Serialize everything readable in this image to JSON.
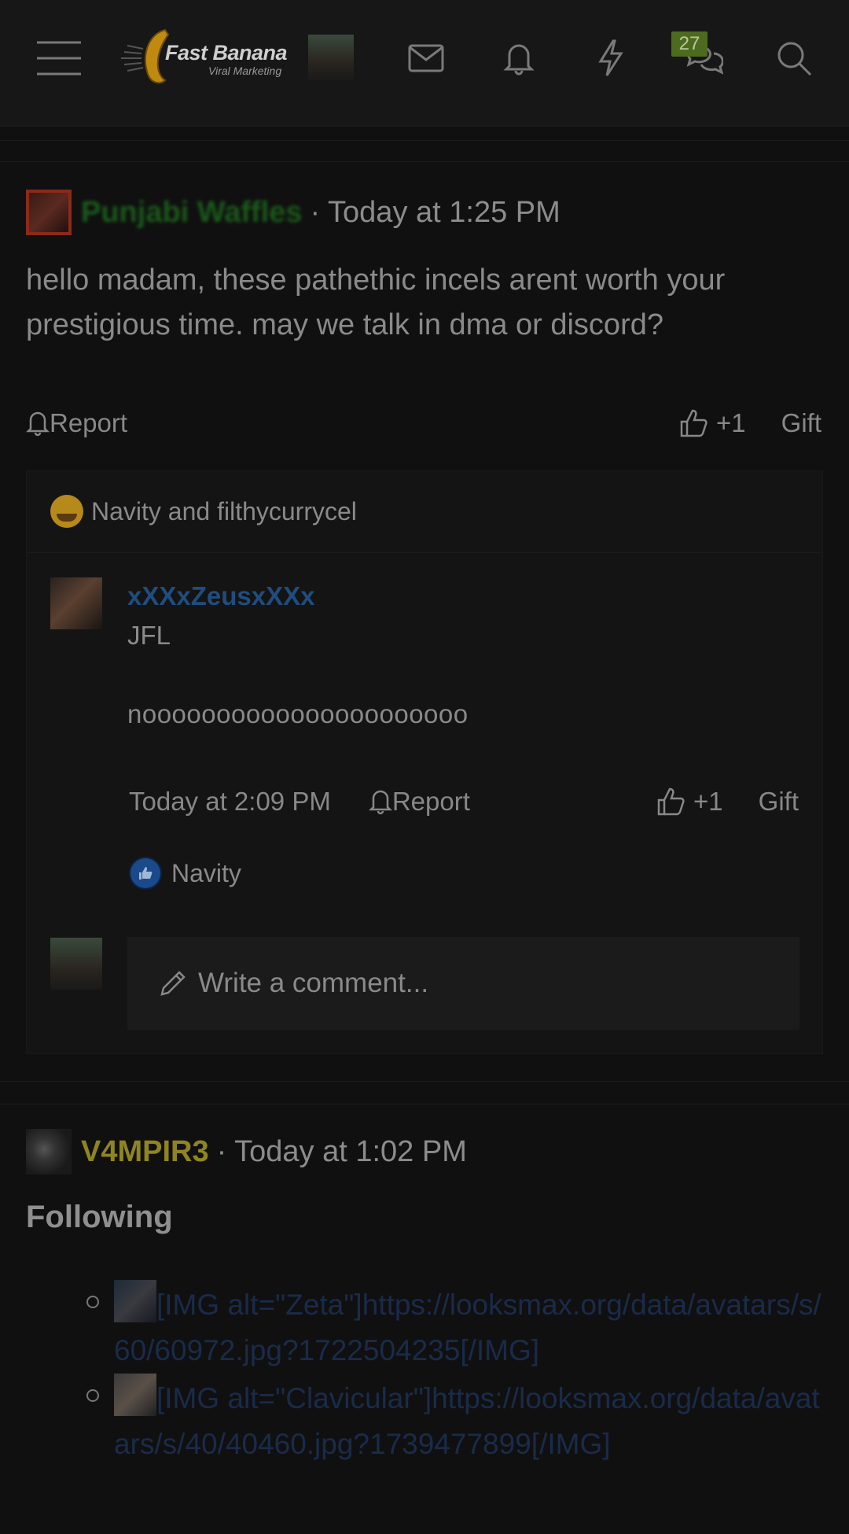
{
  "topbar": {
    "logo_title": "Fast Banana",
    "logo_subtitle": "Viral Marketing",
    "badge_count": "27",
    "icons": [
      "menu-icon",
      "mail-icon",
      "bell-icon",
      "lightning-icon",
      "chat-icon",
      "search-icon"
    ]
  },
  "post1": {
    "username": "Punjabi Waffles",
    "time": "· Today at 1:25 PM",
    "body": "hello madam, these pathethic incels arent worth your prestigious time. may we talk in dma or discord?",
    "report": "Report",
    "likes": "+1",
    "gift": "Gift",
    "reactions": "Navity and filthycurrycel",
    "comment": {
      "username": "xXXxZeusxXXx",
      "line1": "JFL",
      "line2": "noooooooooooooooooooooo",
      "time": "Today at 2:09 PM",
      "report": "Report",
      "likes": "+1",
      "gift": "Gift",
      "liked_by": "Navity"
    },
    "write_comment_placeholder": "Write a comment..."
  },
  "post2": {
    "username": "V4MPIR3",
    "time": "· Today at 1:02 PM",
    "heading": "Following",
    "items": [
      {
        "text": "[IMG alt=\"Zeta\"]https://looksmax.org/data/avatars/s/60/60972.jpg?1722504235[/IMG]"
      },
      {
        "text": "[IMG alt=\"Clavicular\"]https://looksmax.org/data/avatars/s/40/40460.jpg?1739477899[/IMG]"
      }
    ]
  },
  "colors": {
    "background": "#101010",
    "badge": "#4c6b1e",
    "username_blue": "#1f4d7f",
    "username_gold": "#8f8520",
    "link_dark": "#1a2b4a"
  }
}
